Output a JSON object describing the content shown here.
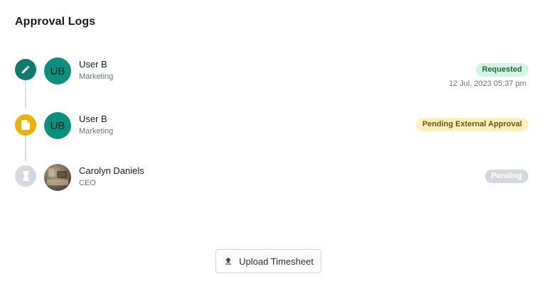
{
  "page": {
    "title": "Approval Logs"
  },
  "logs": [
    {
      "icon": "pencil-icon",
      "icon_color": "#0f7a6c",
      "avatar_initials": "UB",
      "name": "User B",
      "department": "Marketing",
      "status": "Requested",
      "timestamp": "12 Jul, 2023 05:37 pm"
    },
    {
      "icon": "document-icon",
      "icon_color": "#e6b400",
      "avatar_initials": "UB",
      "name": "User B",
      "department": "Marketing",
      "status": "Pending External Approval"
    },
    {
      "icon": "hourglass-icon",
      "icon_color": "#d4d7dd",
      "avatar_photo": true,
      "name": "Carolyn Daniels",
      "department": "CEO",
      "status": "Pending"
    }
  ],
  "actions": {
    "upload_label": "Upload Timesheet"
  },
  "colors": {
    "avatar_bg": "#0d8f7e",
    "requested_badge_bg": "#d3f5e2",
    "external_badge_bg": "#fbf1bf",
    "pending_badge_bg": "#d4d7dd"
  }
}
